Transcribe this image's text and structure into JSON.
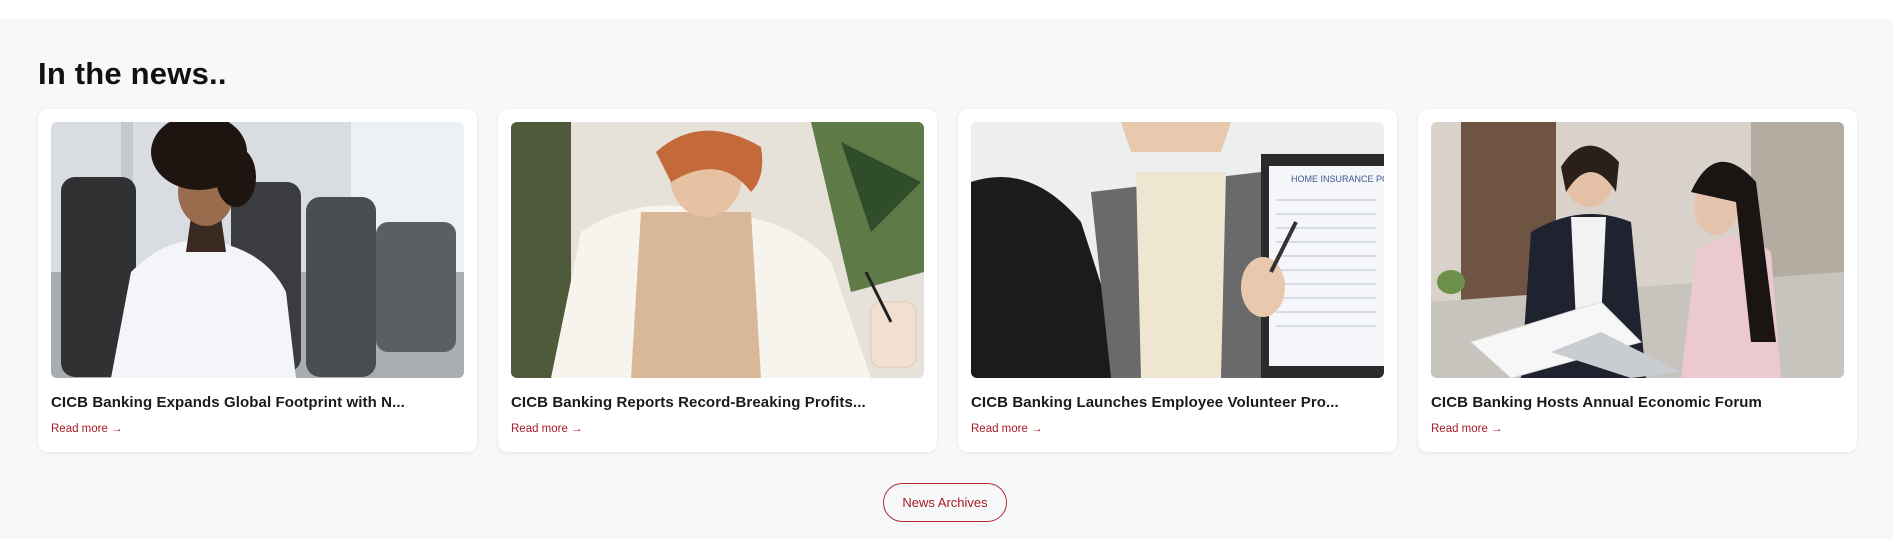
{
  "section": {
    "heading": "In the news..",
    "archives_label": "News Archives"
  },
  "cards": [
    {
      "title": "CICB Banking Expands Global Footprint with N...",
      "read_more": "Read more →",
      "image": "woman-in-lab-coat-photo"
    },
    {
      "title": "CICB Banking Reports Record-Breaking Profits...",
      "read_more": "Read more →",
      "image": "woman-writing-at-desk-photo"
    },
    {
      "title": "CICB Banking Launches Employee Volunteer Pro...",
      "read_more": "Read more →",
      "image": "insurance-policy-meeting-photo",
      "image_text": "HOME INSURANCE POLICY"
    },
    {
      "title": "CICB Banking Hosts Annual Economic Forum",
      "read_more": "Read more →",
      "image": "two-women-reviewing-documents-photo"
    }
  ],
  "colors": {
    "accent": "#a41c24",
    "section_bg": "#f7f8fa",
    "card_bg": "#ffffff"
  }
}
